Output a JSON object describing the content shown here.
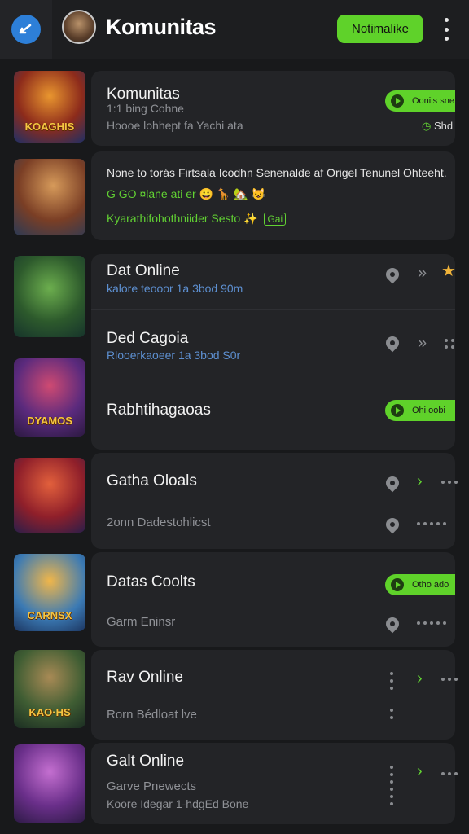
{
  "header": {
    "title": "Komunitas",
    "action_label": "Notimalike"
  },
  "items": [
    {
      "title": "Komunitas",
      "line1": "1:1 bing Cohne",
      "line2": "Hoooe lohhept fa Yachi ata",
      "badge": "Ooniis sne",
      "tag": "Shd",
      "thumb_caption": "KOAGHIS"
    },
    {
      "line1": "None to torás Firtsala Icodhn Senenalde af Origel Tenunel Ohteeht.",
      "line2": "G GO ¤lane ati er 😀 🦒 🏡 😺",
      "line3": "Kyarathifohothniider Sesto ✨",
      "line3_badge": "Gai"
    },
    {
      "title": "Dat Online",
      "sub": "kalore teooor 1a 3bod 90m"
    },
    {
      "title": "Ded Cagoia",
      "sub": "Rlooerkaoeer 1a 3bod S0r"
    },
    {
      "title": "Rabhtihagaoas",
      "badge": "Ohi oobi",
      "thumb_caption": "DYAMOS"
    },
    {
      "title": "Gatha Oloals",
      "sub": "2onn Dadestohlicst"
    },
    {
      "title": "Datas Coolts",
      "sub": "Garm Eninsr",
      "badge": "Otho ado",
      "thumb_caption": "CARNSX"
    },
    {
      "title": "Rav Online",
      "sub": "Rorn Bédloat lve",
      "thumb_caption": "KAO·HS"
    },
    {
      "title": "Galt Online",
      "sub": "Garve Pnewects",
      "sub2": "Koore Idegar 1-hdgEd Bone"
    }
  ]
}
